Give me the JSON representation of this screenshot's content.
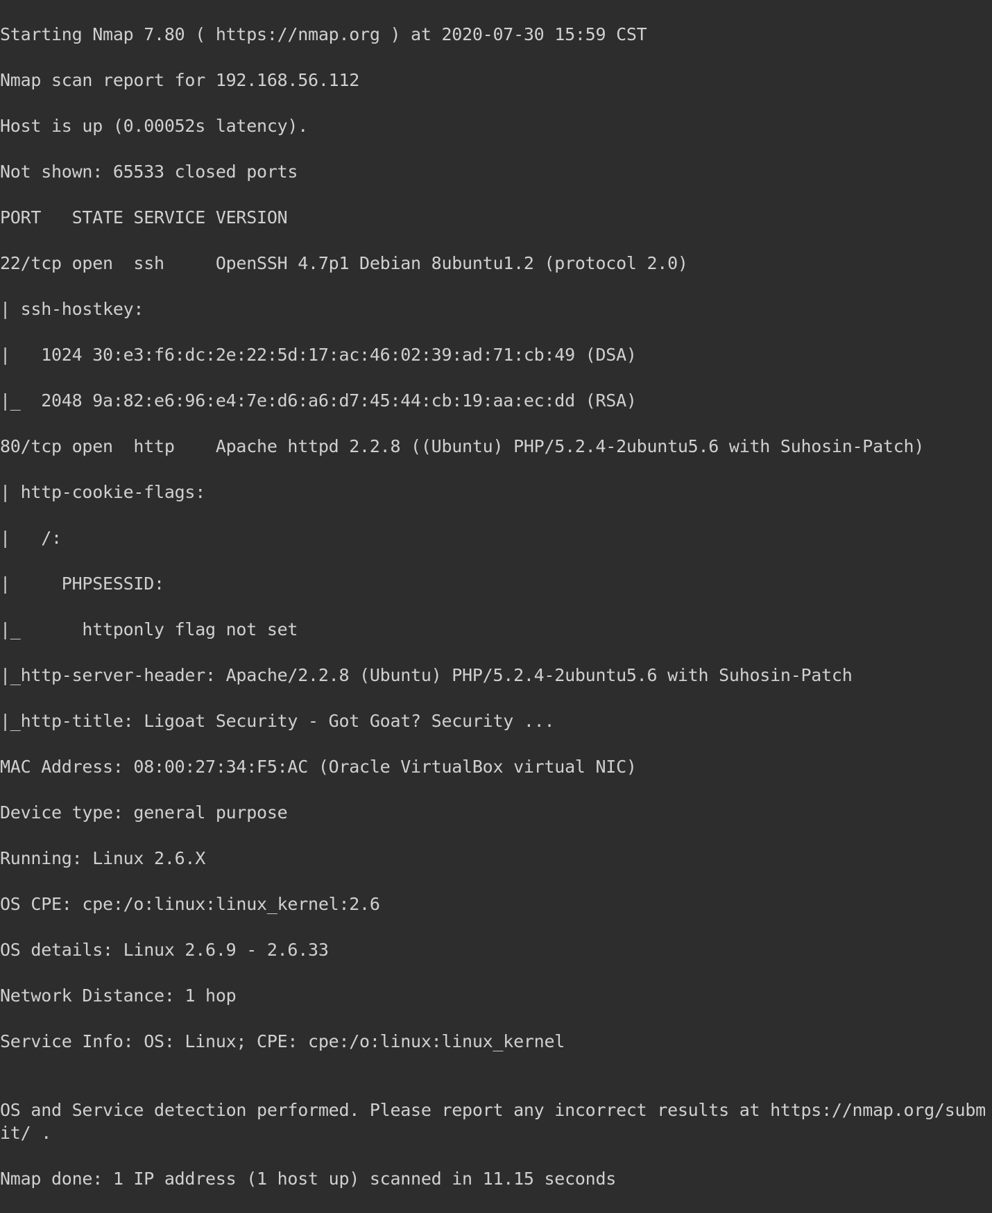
{
  "terminal": {
    "lines": {
      "l0": "Starting Nmap 7.80 ( https://nmap.org ) at 2020-07-30 15:59 CST",
      "l1": "Nmap scan report for 192.168.56.112",
      "l2": "Host is up (0.00052s latency).",
      "l3": "Not shown: 65533 closed ports",
      "l4": "PORT   STATE SERVICE VERSION",
      "l5": "22/tcp open  ssh     OpenSSH 4.7p1 Debian 8ubuntu1.2 (protocol 2.0)",
      "l6": "| ssh-hostkey:",
      "l7": "|   1024 30:e3:f6:dc:2e:22:5d:17:ac:46:02:39:ad:71:cb:49 (DSA)",
      "l8": "|_  2048 9a:82:e6:96:e4:7e:d6:a6:d7:45:44:cb:19:aa:ec:dd (RSA)",
      "l9": "80/tcp open  http    Apache httpd 2.2.8 ((Ubuntu) PHP/5.2.4-2ubuntu5.6 with Suhosin-Patch)",
      "l10": "| http-cookie-flags:",
      "l11": "|   /:",
      "l12": "|     PHPSESSID:",
      "l13": "|_      httponly flag not set",
      "l14": "|_http-server-header: Apache/2.2.8 (Ubuntu) PHP/5.2.4-2ubuntu5.6 with Suhosin-Patch",
      "l15": "|_http-title: Ligoat Security - Got Goat? Security ...",
      "l16": "MAC Address: 08:00:27:34:F5:AC (Oracle VirtualBox virtual NIC)",
      "l17": "Device type: general purpose",
      "l18": "Running: Linux 2.6.X",
      "l19": "OS CPE: cpe:/o:linux:linux_kernel:2.6",
      "l20": "OS details: Linux 2.6.9 - 2.6.33",
      "l21": "Network Distance: 1 hop",
      "l22": "Service Info: OS: Linux; CPE: cpe:/o:linux:linux_kernel",
      "l23": "",
      "l24": "OS and Service detection performed. Please report any incorrect results at https://nmap.org/submit/ .",
      "l25": "Nmap done: 1 IP address (1 host up) scanned in 11.15 seconds"
    }
  }
}
